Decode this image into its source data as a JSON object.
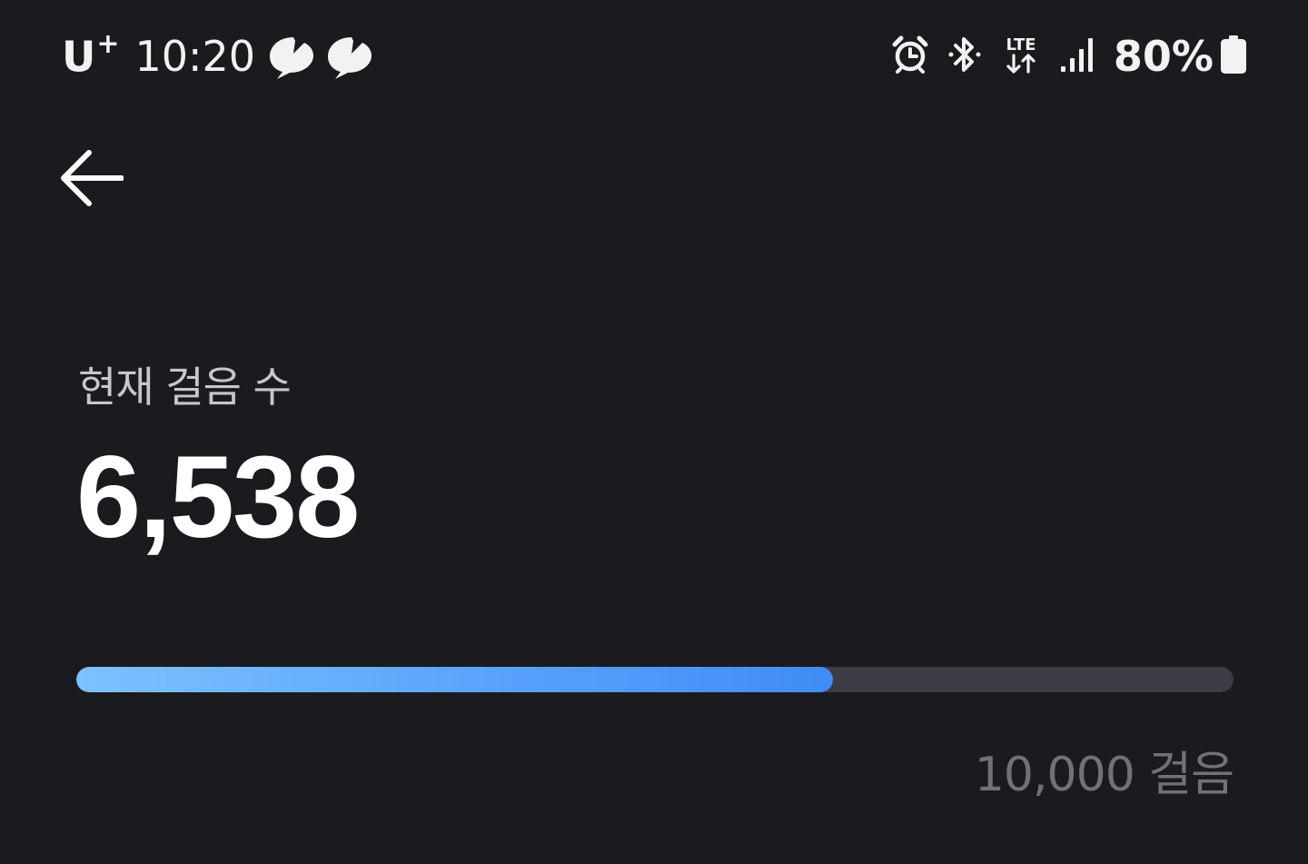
{
  "status_bar": {
    "carrier": "U",
    "carrier_sup": "+",
    "time": "10:20",
    "battery_percent": "80%",
    "network": "LTE",
    "battery_level": 0.8,
    "icons": [
      "notification-app-icon",
      "notification-app-icon",
      "alarm-icon",
      "bluetooth-icon",
      "lte-data-icon",
      "signal-icon",
      "battery-icon"
    ]
  },
  "header": {
    "back_icon": "arrow-left-icon"
  },
  "steps": {
    "label": "현재 걸음 수",
    "value": "6,538",
    "current": 6538,
    "goal": 10000,
    "goal_label": "10,000 걸음"
  },
  "colors": {
    "background": "#1a1a1f",
    "progress_start": "#7cc2fe",
    "progress_end": "#3f8cf7",
    "track": "#3c3c45"
  }
}
